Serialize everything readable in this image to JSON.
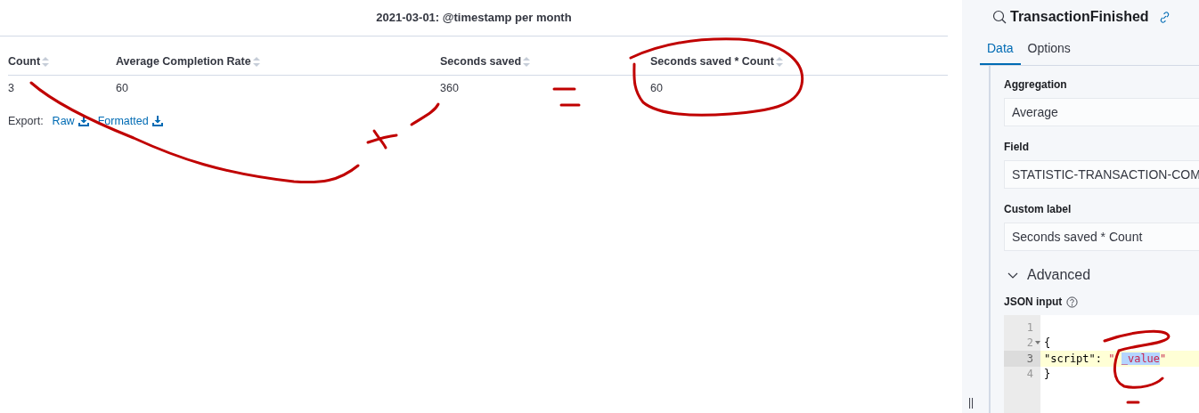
{
  "table": {
    "title": "2021-03-01: @timestamp per month",
    "columns": [
      "Count",
      "Average Completion Rate",
      "Seconds saved",
      "Seconds saved * Count"
    ],
    "rows": [
      [
        "3",
        "60",
        "360",
        "60"
      ]
    ],
    "export": {
      "label": "Export:",
      "links": [
        "Raw",
        "Formatted"
      ]
    }
  },
  "panel": {
    "title": "TransactionFinished",
    "tabs": [
      {
        "label": "Data",
        "selected": true
      },
      {
        "label": "Options",
        "selected": false
      }
    ],
    "fields": [
      {
        "label": "Aggregation",
        "value": "Average"
      },
      {
        "label": "Field",
        "value": "STATISTIC-TRANSACTION-COM"
      },
      {
        "label": "Custom label",
        "value": "Seconds saved * Count"
      }
    ],
    "advanced": {
      "label": "Advanced",
      "expanded": true
    },
    "json_input": {
      "label": "JSON input",
      "lines": [
        {
          "number": "1",
          "active": false,
          "foldable": false
        },
        {
          "number": "2",
          "active": false,
          "foldable": true,
          "tokens": [
            {
              "kind": "plain",
              "text": "{"
            }
          ]
        },
        {
          "number": "3",
          "active": true,
          "foldable": false,
          "tokens": [
            {
              "kind": "plain",
              "text": "\"script\": "
            },
            {
              "kind": "string",
              "text": "\" "
            },
            {
              "kind": "selection",
              "text": "_value"
            },
            {
              "kind": "string",
              "text": "\""
            }
          ]
        },
        {
          "number": "4",
          "active": false,
          "foldable": false,
          "tokens": [
            {
              "kind": "plain",
              "text": "}"
            }
          ]
        }
      ]
    }
  },
  "resize_handle": "||"
}
